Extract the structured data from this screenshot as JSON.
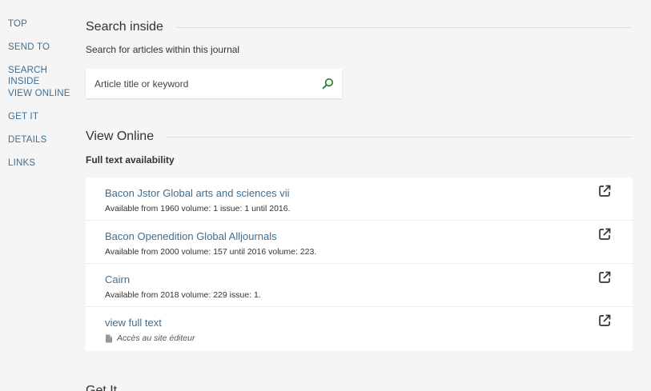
{
  "nav": {
    "items": [
      "TOP",
      "SEND TO",
      "SEARCH INSIDE",
      "VIEW ONLINE",
      "GET IT",
      "DETAILS",
      "LINKS"
    ]
  },
  "search_inside": {
    "heading": "Search inside",
    "subtitle": "Search for articles within this journal",
    "placeholder": "Article title or keyword",
    "icon": "search-icon"
  },
  "view_online": {
    "heading": "View Online",
    "label": "Full text availability",
    "results": [
      {
        "title": "Bacon Jstor Global arts and sciences vii",
        "desc": "Available from 1960 volume: 1 issue: 1 until 2016."
      },
      {
        "title": "Bacon Openedition Global Alljournals",
        "desc": "Available from 2000 volume: 157 until 2016 volume: 223."
      },
      {
        "title": "Cairn",
        "desc": "Available from 2018 volume: 229 issue: 1."
      },
      {
        "title": "view full text",
        "desc": "Accès au site éditeur"
      }
    ]
  },
  "get_it": {
    "heading": "Get It"
  },
  "colors": {
    "link": "#3d6e94",
    "search_icon": "#2e7d32",
    "background": "#f5f5f5"
  }
}
